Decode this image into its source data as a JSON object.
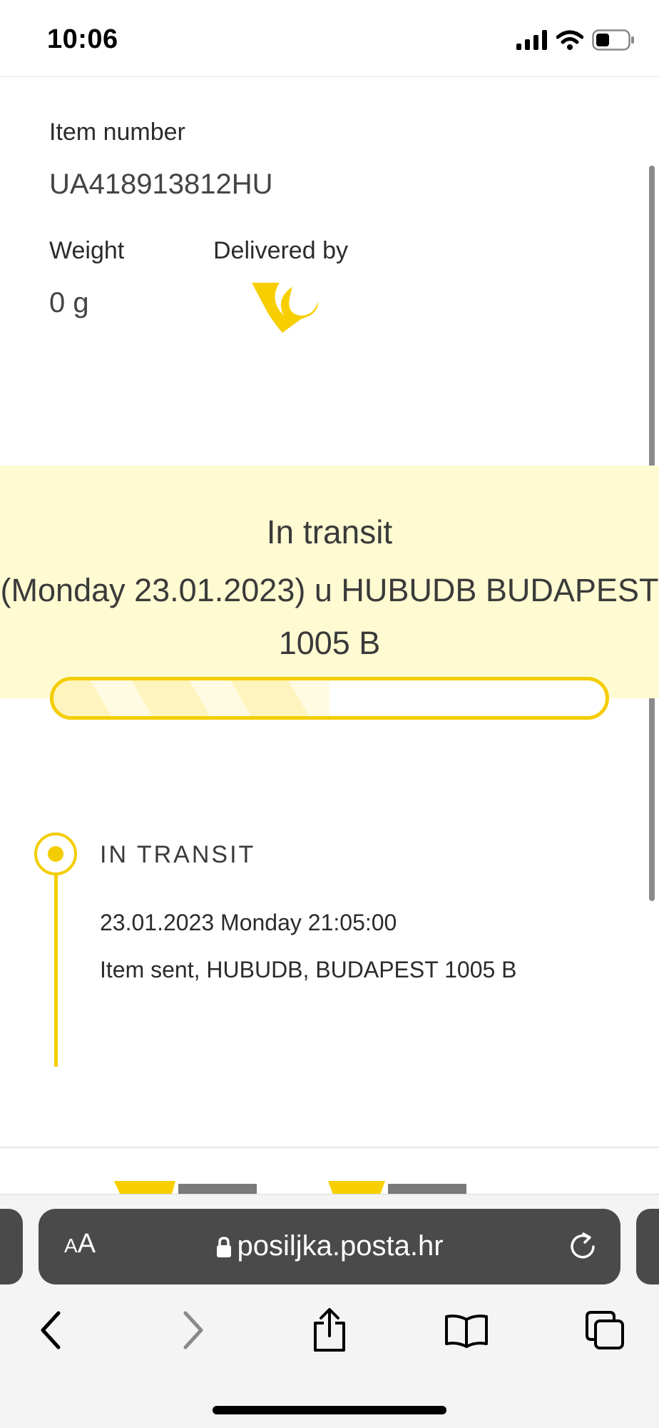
{
  "status_bar": {
    "time": "10:06"
  },
  "item": {
    "number_label": "Item number",
    "number_value": "UA418913812HU",
    "weight_label": "Weight",
    "weight_value": "0 g",
    "delivered_by_label": "Delivered by"
  },
  "status_band": {
    "status": "In transit",
    "detail_line1": "(Monday 23.01.2023) u HUBUDB BUDAPEST",
    "detail_line2": "1005 B",
    "progress_fraction": 0.5
  },
  "timeline": {
    "events": [
      {
        "title": "IN TRANSIT",
        "datetime": "23.01.2023 Monday 21:05:00",
        "description": "Item sent, HUBUDB, BUDAPEST 1005 B"
      }
    ]
  },
  "browser": {
    "aa_small": "A",
    "aa_large": "A",
    "url": "posiljka.posta.hr"
  },
  "colors": {
    "brand_yellow": "#f3cd00",
    "band_background": "#fefad2",
    "url_bar": "#4a4a4a"
  },
  "icons": {
    "signal": "cellular-signal-icon",
    "wifi": "wifi-icon",
    "battery": "battery-icon",
    "lock": "lock-icon",
    "reload": "reload-icon",
    "back": "chevron-left-icon",
    "forward": "chevron-right-icon",
    "share": "share-icon",
    "bookmarks": "book-icon",
    "tabs": "tabs-icon"
  }
}
